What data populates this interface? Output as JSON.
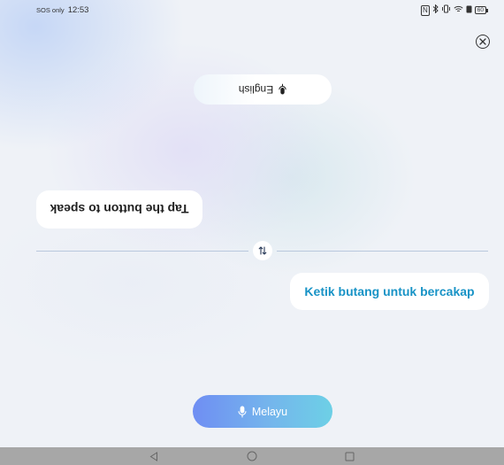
{
  "status_bar": {
    "carrier": "SOS only",
    "time": "12:53",
    "battery": "60"
  },
  "top_language": {
    "label": "English",
    "icon": "microphone-icon"
  },
  "other_bubble": {
    "text": "Tap the button to speak"
  },
  "self_bubble": {
    "text": "Ketik butang untuk bercakap"
  },
  "bottom_language": {
    "label": "Melayu",
    "icon": "microphone-icon"
  },
  "colors": {
    "accent_text": "#1893c6",
    "button_gradient_start": "#6f8ef3",
    "button_gradient_end": "#6dd0e6",
    "navbar": "#a7a7a7"
  }
}
